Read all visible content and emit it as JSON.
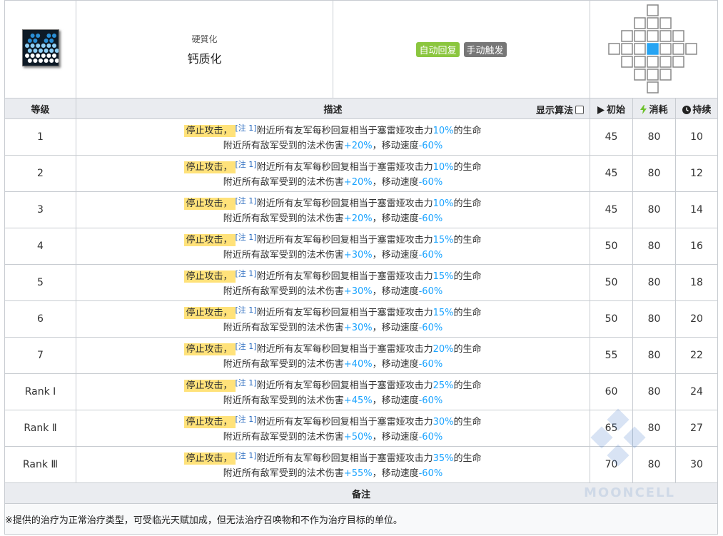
{
  "skill": {
    "jp_name": "硬質化",
    "cn_name": "钙质化",
    "tags": [
      {
        "label": "自动回复",
        "color": "#8bc63f"
      },
      {
        "label": "手动触发",
        "color": "#777777"
      }
    ]
  },
  "columns": {
    "level": "等级",
    "description": "描述",
    "show_algo": "显示算法",
    "initial": "初始",
    "cost": "消耗",
    "duration": "持续"
  },
  "desc_parts": {
    "stop_attack": "停止攻击，",
    "note": "[注 1]",
    "heal_prefix": "附近所有友军每秒回复相当于塞雷娅攻击力",
    "heal_suffix": "的生命",
    "dmg_prefix": "附近所有敌军受到的法术伤害",
    "move_prefix": "，移动速度",
    "move_value": "-60%"
  },
  "levels": [
    {
      "level": "1",
      "heal": "10%",
      "dmg": "+20%",
      "initial": "45",
      "cost": "80",
      "duration": "10"
    },
    {
      "level": "2",
      "heal": "10%",
      "dmg": "+20%",
      "initial": "45",
      "cost": "80",
      "duration": "12"
    },
    {
      "level": "3",
      "heal": "10%",
      "dmg": "+20%",
      "initial": "45",
      "cost": "80",
      "duration": "14"
    },
    {
      "level": "4",
      "heal": "15%",
      "dmg": "+30%",
      "initial": "50",
      "cost": "80",
      "duration": "16"
    },
    {
      "level": "5",
      "heal": "15%",
      "dmg": "+30%",
      "initial": "50",
      "cost": "80",
      "duration": "18"
    },
    {
      "level": "6",
      "heal": "15%",
      "dmg": "+30%",
      "initial": "50",
      "cost": "80",
      "duration": "20"
    },
    {
      "level": "7",
      "heal": "20%",
      "dmg": "+40%",
      "initial": "55",
      "cost": "80",
      "duration": "22"
    },
    {
      "level": "Rank Ⅰ",
      "heal": "25%",
      "dmg": "+45%",
      "initial": "60",
      "cost": "80",
      "duration": "24"
    },
    {
      "level": "Rank Ⅱ",
      "heal": "30%",
      "dmg": "+50%",
      "initial": "65",
      "cost": "80",
      "duration": "27"
    },
    {
      "level": "Rank Ⅲ",
      "heal": "35%",
      "dmg": "+55%",
      "initial": "70",
      "cost": "80",
      "duration": "30"
    }
  ],
  "footer": {
    "heading": "备注",
    "text": "※提供的治疗为正常治疗类型，可受临光天赋加成，但无法治疗召唤物和不作为治疗目标的单位。"
  },
  "watermark": "MOONCELL",
  "colors": {
    "highlight": "#ffe27a",
    "number_blue": "#1aa3ff",
    "tag_green": "#8bc63f",
    "tag_gray": "#777777",
    "range_center": "#27a4f3"
  }
}
